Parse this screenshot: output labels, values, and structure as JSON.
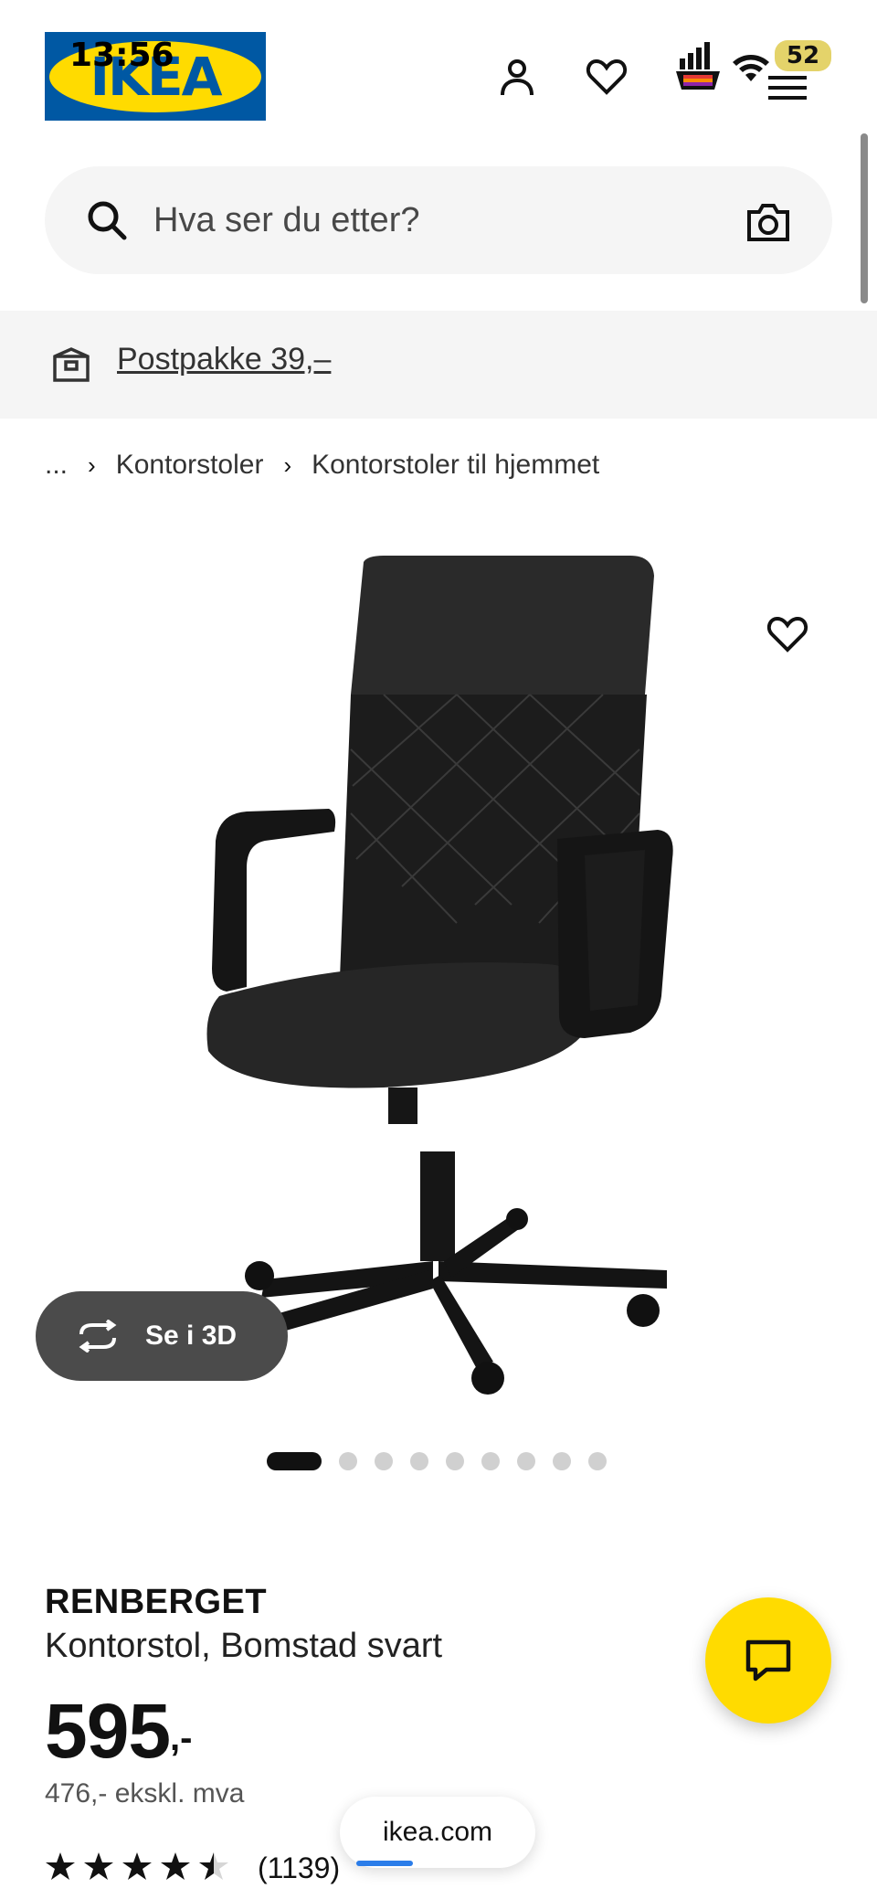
{
  "status_bar": {
    "time": "13:56",
    "battery": "52"
  },
  "header": {
    "logo_text": "IKEA"
  },
  "search": {
    "placeholder": "Hva ser du etter?"
  },
  "banner": {
    "text": "Postpakke 39,–"
  },
  "breadcrumb": {
    "ellipsis": "...",
    "items": [
      "Kontorstoler",
      "Kontorstoler til hjemmet"
    ]
  },
  "product_image": {
    "view3d_label": "Se i 3D",
    "carousel_count": 9,
    "carousel_active": 1
  },
  "product": {
    "name": "RENBERGET",
    "description": "Kontorstol, Bomstad svart",
    "price": "595",
    "price_suffix": ",-",
    "price_excl_vat": "476,- ekskl. mva",
    "rating": 4.5,
    "review_count": "(1139)"
  },
  "browser": {
    "url": "ikea.com"
  },
  "colors": {
    "ikea_blue": "#0058a3",
    "ikea_yellow": "#ffdb00"
  }
}
